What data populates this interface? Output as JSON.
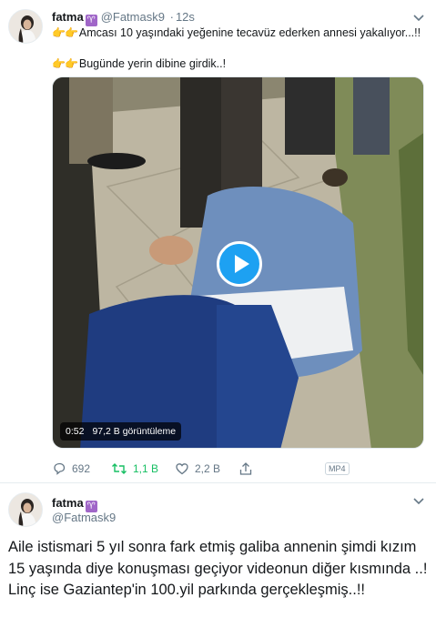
{
  "tweet1": {
    "author_name": "fatma",
    "badge_icon": "aries-sign-icon",
    "author_handle": "@Fatmask9",
    "separator": "·",
    "time": "12s",
    "line1_emoji": "👉👉",
    "line1_text": "Amcası 10 yaşındaki yeğenine tecavüz ederken annesi yakalıyor...!!",
    "line2_emoji": "👉👉",
    "line2_text": "Bugünde yerin dibine girdik..!",
    "video": {
      "duration": "0:52",
      "views": "97,2 B görüntüleme"
    },
    "actions": {
      "replies": "692",
      "retweets": "1,1 B",
      "likes": "2,2 B",
      "format_badge": "MP4"
    }
  },
  "tweet2": {
    "author_name": "fatma",
    "badge_icon": "aries-sign-icon",
    "author_handle": "@Fatmask9",
    "text": "Aile istismari 5 yıl sonra fark etmiş galiba annenin şimdi kızım 15 yaşında diye konuşması geçiyor videonun diğer kısmında ..! Linç ise  Gaziantep'in  100.yil parkında gerçekleşmiş..!!"
  },
  "colors": {
    "link_blue": "#1da1f2",
    "secondary_text": "#657786",
    "retweet_green": "#17bf63",
    "badge_purple": "#a066c8"
  }
}
